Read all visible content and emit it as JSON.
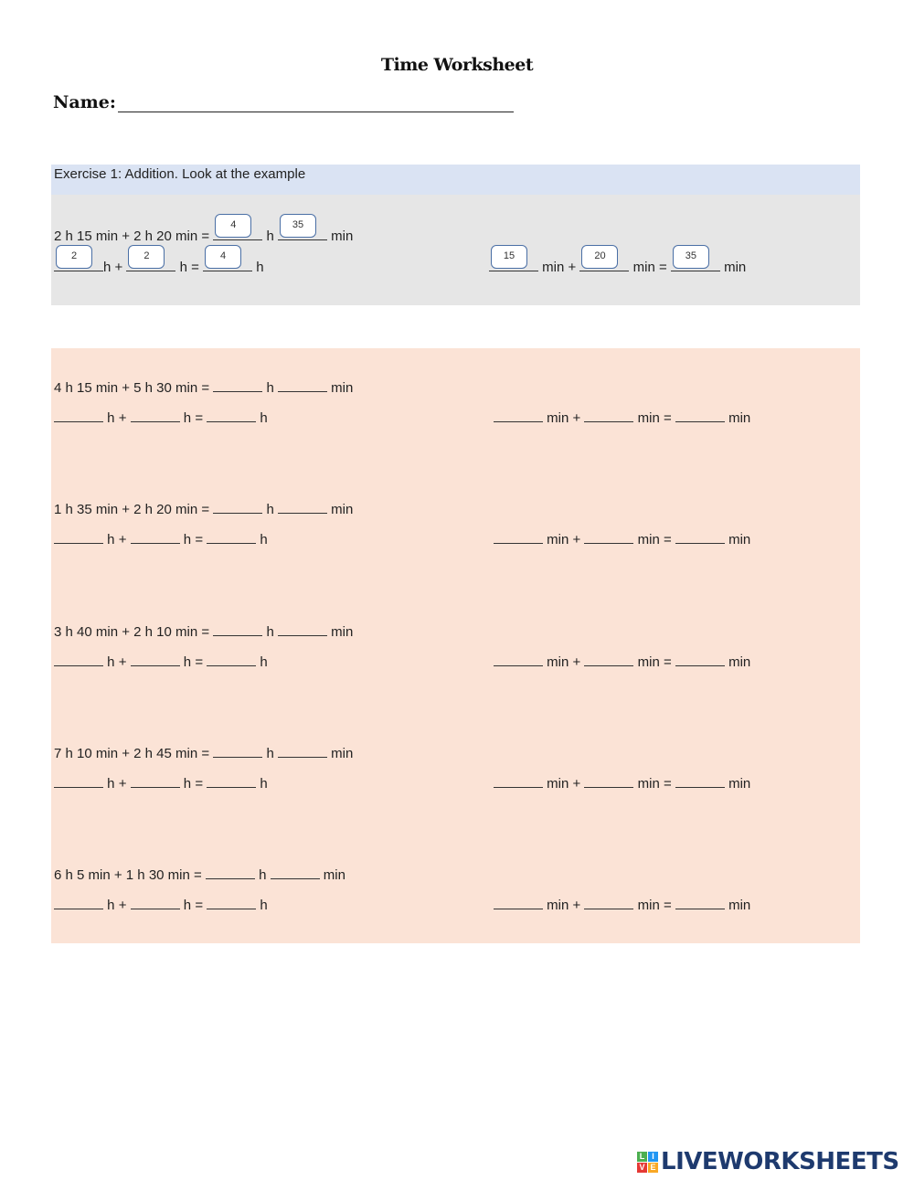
{
  "title": "Time Worksheet",
  "name_label": "Name:",
  "exercise": {
    "header": "Exercise 1: Addition. Look at the example",
    "example": {
      "equation": "2 h 15 min + 2 h 20 min =",
      "answer_hours": "4",
      "answer_minutes": "35",
      "hours_parts": [
        "2",
        "2",
        "4"
      ],
      "minutes_parts": [
        "15",
        "20",
        "35"
      ]
    }
  },
  "units": {
    "h": "h",
    "min": "min",
    "plus": "+",
    "equals": "="
  },
  "problems": [
    {
      "equation": "4 h 15 min + 5 h 30 min ="
    },
    {
      "equation": "1 h 35 min + 2 h 20 min ="
    },
    {
      "equation": "3 h 40 min + 2 h 10 min ="
    },
    {
      "equation": "7 h 10 min + 2 h 45 min ="
    },
    {
      "equation": "6 h 5 min + 1 h 30 min ="
    }
  ],
  "logo": {
    "text": "LIVEWORKSHEETS",
    "letters": [
      "L",
      "I",
      "V",
      "E"
    ],
    "colors": [
      "#4caf50",
      "#2196f3",
      "#e53935",
      "#f9a825"
    ]
  }
}
